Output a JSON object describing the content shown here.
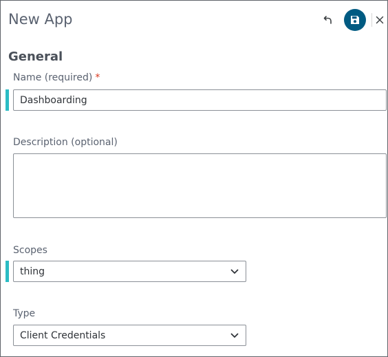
{
  "header": {
    "title": "New App",
    "actions": [
      {
        "name": "undo",
        "icon": "undo-icon"
      },
      {
        "name": "save",
        "icon": "save-icon"
      },
      {
        "name": "close",
        "icon": "close-icon"
      }
    ]
  },
  "section": {
    "title": "General"
  },
  "fields": {
    "name": {
      "label": "Name (required)",
      "required_marker": "*",
      "value": "Dashboarding"
    },
    "description": {
      "label": "Description (optional)",
      "value": ""
    },
    "scopes": {
      "label": "Scopes",
      "selected": "thing"
    },
    "type": {
      "label": "Type",
      "selected": "Client Credentials"
    }
  },
  "colors": {
    "accent_bar": "#2bbcc4",
    "save_button": "#005b82",
    "required": "#d9381e"
  }
}
